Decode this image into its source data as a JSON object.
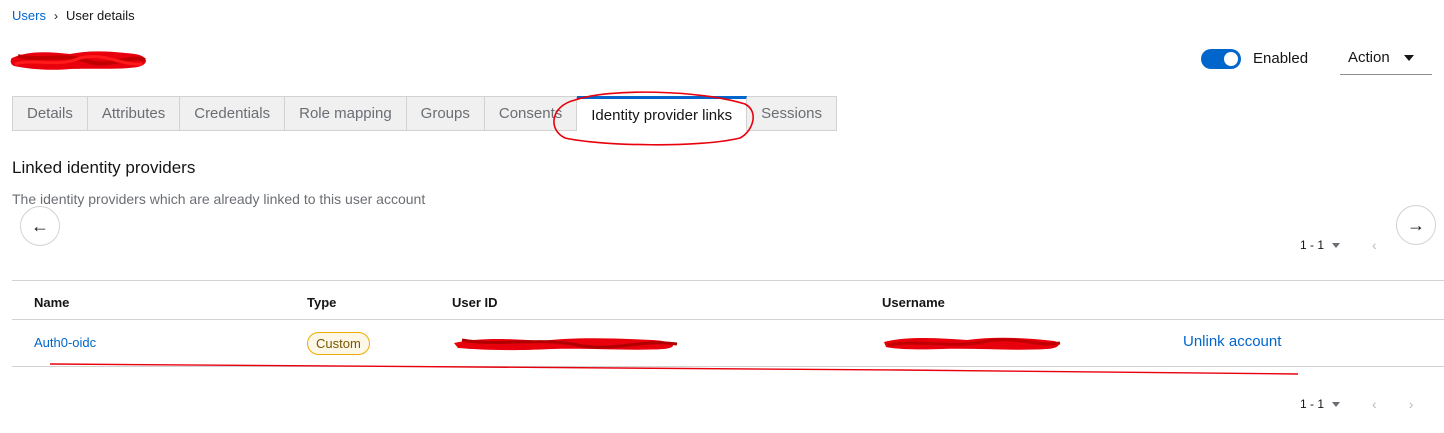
{
  "breadcrumb": {
    "parent": "Users",
    "separator": "›",
    "current": "User details"
  },
  "header": {
    "enabled_label": "Enabled",
    "enabled": true,
    "action_label": "Action"
  },
  "tabs": [
    {
      "label": "Details",
      "active": false
    },
    {
      "label": "Attributes",
      "active": false
    },
    {
      "label": "Credentials",
      "active": false
    },
    {
      "label": "Role mapping",
      "active": false
    },
    {
      "label": "Groups",
      "active": false
    },
    {
      "label": "Consents",
      "active": false
    },
    {
      "label": "Identity provider links",
      "active": true
    },
    {
      "label": "Sessions",
      "active": false
    }
  ],
  "section": {
    "title": "Linked identity providers",
    "description": "The identity providers which are already linked to this user account"
  },
  "nav": {
    "prev_icon": "arrow-left-icon",
    "next_icon": "arrow-right-icon",
    "prev_glyph": "←",
    "next_glyph": "→"
  },
  "pagination": {
    "range": "1 - 1",
    "prev_glyph": "‹",
    "next_glyph": "›"
  },
  "table": {
    "columns": [
      "Name",
      "Type",
      "User ID",
      "Username"
    ],
    "rows": [
      {
        "name": "Auth0-oidc",
        "type": "Custom",
        "action": "Unlink account"
      }
    ]
  },
  "colors": {
    "accent": "#0066cc",
    "annotation": "#e8000d",
    "badge_border": "#f0ab00"
  }
}
